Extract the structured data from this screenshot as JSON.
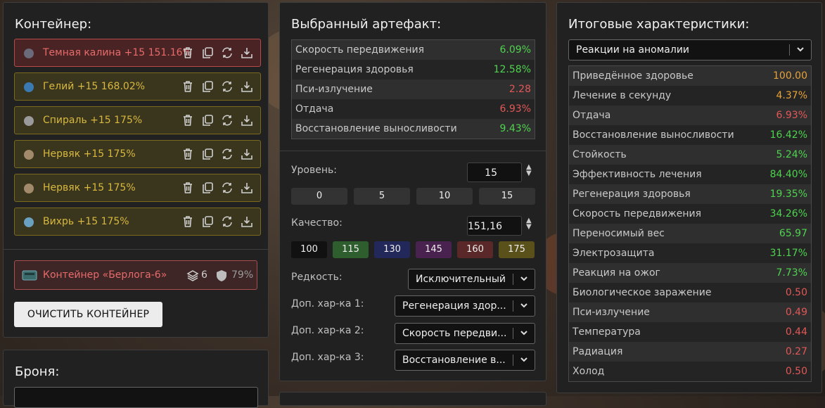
{
  "container": {
    "title": "Контейнер:",
    "items": [
      {
        "name": "Темная калина +15 151.16%",
        "style": "red"
      },
      {
        "name": "Гелий +15 168.02%",
        "style": "gold"
      },
      {
        "name": "Спираль +15 175%",
        "style": "gold"
      },
      {
        "name": "Нервяк +15 175%",
        "style": "gold"
      },
      {
        "name": "Нервяк +15 175%",
        "style": "gold"
      },
      {
        "name": "Вихрь +15 175%",
        "style": "gold"
      }
    ],
    "box": {
      "name": "Контейнер «Берлога-6»",
      "slots": "6",
      "protection": "79%"
    },
    "clear_label": "ОЧИСТИТЬ КОНТЕЙНЕР"
  },
  "armor": {
    "title": "Броня:"
  },
  "artifact": {
    "title": "Выбранный артефакт:",
    "stats": [
      {
        "label": "Скорость передвижения",
        "value": "6.09%",
        "color": "green"
      },
      {
        "label": "Регенерация здоровья",
        "value": "12.58%",
        "color": "green"
      },
      {
        "label": "Пси-излучение",
        "value": "2.28",
        "color": "red"
      },
      {
        "label": "Отдача",
        "value": "6.93%",
        "color": "red"
      },
      {
        "label": "Восстановление выносливости",
        "value": "9.43%",
        "color": "green"
      }
    ],
    "level_label": "Уровень:",
    "level_value": "15",
    "level_presets": [
      "0",
      "5",
      "10",
      "15"
    ],
    "quality_label": "Качество:",
    "quality_value": "151,16",
    "quality_presets": [
      {
        "label": "100",
        "color": "#111111"
      },
      {
        "label": "115",
        "color": "#2e5e2e"
      },
      {
        "label": "130",
        "color": "#22285a"
      },
      {
        "label": "145",
        "color": "#4a2250"
      },
      {
        "label": "160",
        "color": "#5a2828"
      },
      {
        "label": "175",
        "color": "#5a501a"
      }
    ],
    "rarity_label": "Редкость:",
    "rarity_value": "Исключительный",
    "extra1_label": "Доп. хар-ка 1:",
    "extra1_value": "Регенерация здор...",
    "extra2_label": "Доп. хар-ка 2:",
    "extra2_value": "Скорость передви...",
    "extra3_label": "Доп. хар-ка 3:",
    "extra3_value": "Восстановление в..."
  },
  "totals": {
    "title": "Итоговые характеристики:",
    "filter_value": "Реакции на аномалии",
    "stats": [
      {
        "label": "Приведённое здоровье",
        "value": "100.00",
        "color": "orange"
      },
      {
        "label": "Лечение в секунду",
        "value": "4.37%",
        "color": "orange"
      },
      {
        "label": "Отдача",
        "value": "6.93%",
        "color": "red"
      },
      {
        "label": "Восстановление выносливости",
        "value": "16.42%",
        "color": "green"
      },
      {
        "label": "Стойкость",
        "value": "5.24%",
        "color": "green"
      },
      {
        "label": "Эффективность лечения",
        "value": "84.40%",
        "color": "green"
      },
      {
        "label": "Регенерация здоровья",
        "value": "19.35%",
        "color": "green"
      },
      {
        "label": "Скорость передвижения",
        "value": "34.26%",
        "color": "green"
      },
      {
        "label": "Переносимый вес",
        "value": "65.97",
        "color": "green"
      },
      {
        "label": "Электрозащита",
        "value": "31.17%",
        "color": "green"
      },
      {
        "label": "Реакция на ожог",
        "value": "7.73%",
        "color": "green"
      },
      {
        "label": "Биологическое заражение",
        "value": "0.50",
        "color": "red"
      },
      {
        "label": "Пси-излучение",
        "value": "0.49",
        "color": "red"
      },
      {
        "label": "Температура",
        "value": "0.44",
        "color": "red"
      },
      {
        "label": "Радиация",
        "value": "0.27",
        "color": "red"
      },
      {
        "label": "Холод",
        "value": "0.50",
        "color": "red"
      }
    ]
  }
}
